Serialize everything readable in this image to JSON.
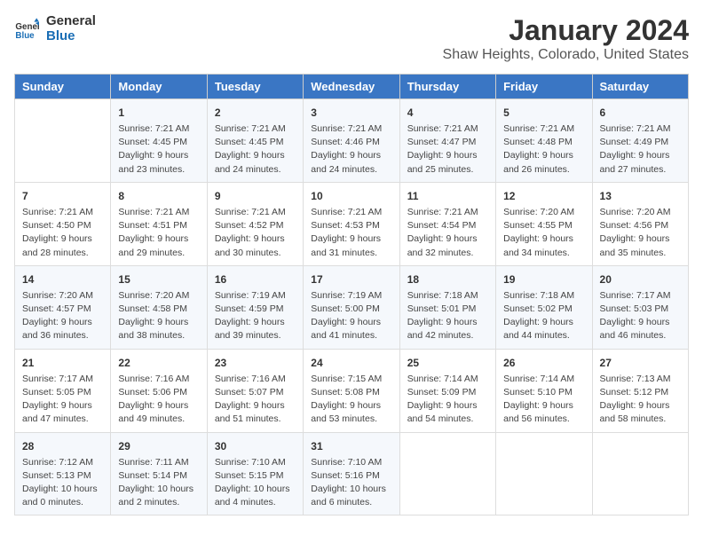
{
  "logo": {
    "text_general": "General",
    "text_blue": "Blue"
  },
  "title": {
    "month_year": "January 2024",
    "location": "Shaw Heights, Colorado, United States"
  },
  "headers": [
    "Sunday",
    "Monday",
    "Tuesday",
    "Wednesday",
    "Thursday",
    "Friday",
    "Saturday"
  ],
  "weeks": [
    [
      {
        "day": "",
        "sunrise": "",
        "sunset": "",
        "daylight": ""
      },
      {
        "day": "1",
        "sunrise": "Sunrise: 7:21 AM",
        "sunset": "Sunset: 4:45 PM",
        "daylight": "Daylight: 9 hours and 23 minutes."
      },
      {
        "day": "2",
        "sunrise": "Sunrise: 7:21 AM",
        "sunset": "Sunset: 4:45 PM",
        "daylight": "Daylight: 9 hours and 24 minutes."
      },
      {
        "day": "3",
        "sunrise": "Sunrise: 7:21 AM",
        "sunset": "Sunset: 4:46 PM",
        "daylight": "Daylight: 9 hours and 24 minutes."
      },
      {
        "day": "4",
        "sunrise": "Sunrise: 7:21 AM",
        "sunset": "Sunset: 4:47 PM",
        "daylight": "Daylight: 9 hours and 25 minutes."
      },
      {
        "day": "5",
        "sunrise": "Sunrise: 7:21 AM",
        "sunset": "Sunset: 4:48 PM",
        "daylight": "Daylight: 9 hours and 26 minutes."
      },
      {
        "day": "6",
        "sunrise": "Sunrise: 7:21 AM",
        "sunset": "Sunset: 4:49 PM",
        "daylight": "Daylight: 9 hours and 27 minutes."
      }
    ],
    [
      {
        "day": "7",
        "sunrise": "Sunrise: 7:21 AM",
        "sunset": "Sunset: 4:50 PM",
        "daylight": "Daylight: 9 hours and 28 minutes."
      },
      {
        "day": "8",
        "sunrise": "Sunrise: 7:21 AM",
        "sunset": "Sunset: 4:51 PM",
        "daylight": "Daylight: 9 hours and 29 minutes."
      },
      {
        "day": "9",
        "sunrise": "Sunrise: 7:21 AM",
        "sunset": "Sunset: 4:52 PM",
        "daylight": "Daylight: 9 hours and 30 minutes."
      },
      {
        "day": "10",
        "sunrise": "Sunrise: 7:21 AM",
        "sunset": "Sunset: 4:53 PM",
        "daylight": "Daylight: 9 hours and 31 minutes."
      },
      {
        "day": "11",
        "sunrise": "Sunrise: 7:21 AM",
        "sunset": "Sunset: 4:54 PM",
        "daylight": "Daylight: 9 hours and 32 minutes."
      },
      {
        "day": "12",
        "sunrise": "Sunrise: 7:20 AM",
        "sunset": "Sunset: 4:55 PM",
        "daylight": "Daylight: 9 hours and 34 minutes."
      },
      {
        "day": "13",
        "sunrise": "Sunrise: 7:20 AM",
        "sunset": "Sunset: 4:56 PM",
        "daylight": "Daylight: 9 hours and 35 minutes."
      }
    ],
    [
      {
        "day": "14",
        "sunrise": "Sunrise: 7:20 AM",
        "sunset": "Sunset: 4:57 PM",
        "daylight": "Daylight: 9 hours and 36 minutes."
      },
      {
        "day": "15",
        "sunrise": "Sunrise: 7:20 AM",
        "sunset": "Sunset: 4:58 PM",
        "daylight": "Daylight: 9 hours and 38 minutes."
      },
      {
        "day": "16",
        "sunrise": "Sunrise: 7:19 AM",
        "sunset": "Sunset: 4:59 PM",
        "daylight": "Daylight: 9 hours and 39 minutes."
      },
      {
        "day": "17",
        "sunrise": "Sunrise: 7:19 AM",
        "sunset": "Sunset: 5:00 PM",
        "daylight": "Daylight: 9 hours and 41 minutes."
      },
      {
        "day": "18",
        "sunrise": "Sunrise: 7:18 AM",
        "sunset": "Sunset: 5:01 PM",
        "daylight": "Daylight: 9 hours and 42 minutes."
      },
      {
        "day": "19",
        "sunrise": "Sunrise: 7:18 AM",
        "sunset": "Sunset: 5:02 PM",
        "daylight": "Daylight: 9 hours and 44 minutes."
      },
      {
        "day": "20",
        "sunrise": "Sunrise: 7:17 AM",
        "sunset": "Sunset: 5:03 PM",
        "daylight": "Daylight: 9 hours and 46 minutes."
      }
    ],
    [
      {
        "day": "21",
        "sunrise": "Sunrise: 7:17 AM",
        "sunset": "Sunset: 5:05 PM",
        "daylight": "Daylight: 9 hours and 47 minutes."
      },
      {
        "day": "22",
        "sunrise": "Sunrise: 7:16 AM",
        "sunset": "Sunset: 5:06 PM",
        "daylight": "Daylight: 9 hours and 49 minutes."
      },
      {
        "day": "23",
        "sunrise": "Sunrise: 7:16 AM",
        "sunset": "Sunset: 5:07 PM",
        "daylight": "Daylight: 9 hours and 51 minutes."
      },
      {
        "day": "24",
        "sunrise": "Sunrise: 7:15 AM",
        "sunset": "Sunset: 5:08 PM",
        "daylight": "Daylight: 9 hours and 53 minutes."
      },
      {
        "day": "25",
        "sunrise": "Sunrise: 7:14 AM",
        "sunset": "Sunset: 5:09 PM",
        "daylight": "Daylight: 9 hours and 54 minutes."
      },
      {
        "day": "26",
        "sunrise": "Sunrise: 7:14 AM",
        "sunset": "Sunset: 5:10 PM",
        "daylight": "Daylight: 9 hours and 56 minutes."
      },
      {
        "day": "27",
        "sunrise": "Sunrise: 7:13 AM",
        "sunset": "Sunset: 5:12 PM",
        "daylight": "Daylight: 9 hours and 58 minutes."
      }
    ],
    [
      {
        "day": "28",
        "sunrise": "Sunrise: 7:12 AM",
        "sunset": "Sunset: 5:13 PM",
        "daylight": "Daylight: 10 hours and 0 minutes."
      },
      {
        "day": "29",
        "sunrise": "Sunrise: 7:11 AM",
        "sunset": "Sunset: 5:14 PM",
        "daylight": "Daylight: 10 hours and 2 minutes."
      },
      {
        "day": "30",
        "sunrise": "Sunrise: 7:10 AM",
        "sunset": "Sunset: 5:15 PM",
        "daylight": "Daylight: 10 hours and 4 minutes."
      },
      {
        "day": "31",
        "sunrise": "Sunrise: 7:10 AM",
        "sunset": "Sunset: 5:16 PM",
        "daylight": "Daylight: 10 hours and 6 minutes."
      },
      {
        "day": "",
        "sunrise": "",
        "sunset": "",
        "daylight": ""
      },
      {
        "day": "",
        "sunrise": "",
        "sunset": "",
        "daylight": ""
      },
      {
        "day": "",
        "sunrise": "",
        "sunset": "",
        "daylight": ""
      }
    ]
  ]
}
